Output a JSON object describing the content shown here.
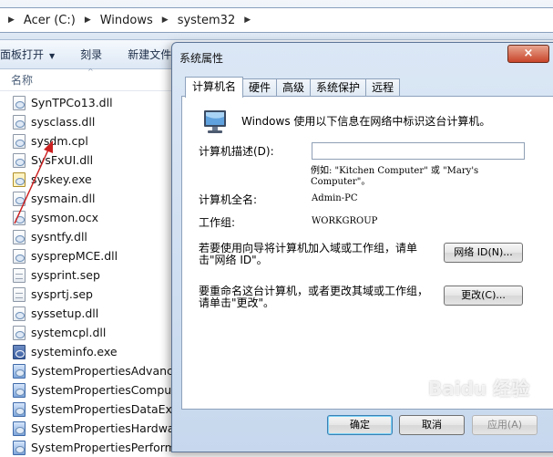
{
  "explorer": {
    "breadcrumb": [
      "Acer (C:)",
      "Windows",
      "system32"
    ],
    "toolbar": {
      "organize": "面板打开",
      "burn": "刻录",
      "new_folder": "新建文件"
    },
    "column_name": "名称",
    "files": [
      {
        "name": "SynTPCo13.dll",
        "icon": "dll-icon"
      },
      {
        "name": "sysclass.dll",
        "icon": "dll-icon"
      },
      {
        "name": "sysdm.cpl",
        "icon": "cpl-icon"
      },
      {
        "name": "SysFxUI.dll",
        "icon": "dll-icon"
      },
      {
        "name": "syskey.exe",
        "icon": "key-exe-icon"
      },
      {
        "name": "sysmain.dll",
        "icon": "dll-icon"
      },
      {
        "name": "sysmon.ocx",
        "icon": "ocx-icon"
      },
      {
        "name": "sysntfy.dll",
        "icon": "dll-icon"
      },
      {
        "name": "sysprepMCE.dll",
        "icon": "dll-icon"
      },
      {
        "name": "sysprint.sep",
        "icon": "doc-icon"
      },
      {
        "name": "sysprtj.sep",
        "icon": "doc-icon"
      },
      {
        "name": "syssetup.dll",
        "icon": "dll-icon"
      },
      {
        "name": "systemcpl.dll",
        "icon": "dll-icon"
      },
      {
        "name": "systeminfo.exe",
        "icon": "exe-icon"
      },
      {
        "name": "SystemPropertiesAdvanced",
        "icon": "sysprop-icon"
      },
      {
        "name": "SystemPropertiesCompute",
        "icon": "sysprop-icon"
      },
      {
        "name": "SystemPropertiesDataExec",
        "icon": "sysprop-icon"
      },
      {
        "name": "SystemPropertiesHardwar",
        "icon": "sysprop-icon"
      },
      {
        "name": "SystemPropertiesPerformance.exe",
        "icon": "sysprop-icon"
      }
    ]
  },
  "dialog": {
    "title": "系统属性",
    "close_glyph": "×",
    "tabs": [
      "计算机名",
      "硬件",
      "高级",
      "系统保护",
      "远程"
    ],
    "active_tab": 0,
    "intro": "Windows 使用以下信息在网络中标识这台计算机。",
    "desc_label": "计算机描述(D):",
    "desc_value": "",
    "example": "例如: \"Kitchen Computer\" 或 \"Mary's Computer\"。",
    "fullname_label": "计算机全名:",
    "fullname_value": "Admin-PC",
    "workgroup_label": "工作组:",
    "workgroup_value": "WORKGROUP",
    "network_text": "若要使用向导将计算机加入域或工作组，请单击\"网络 ID\"。",
    "network_button": "网络 ID(N)...",
    "rename_text": "要重命名这台计算机，或者更改其域或工作组，请单击\"更改\"。",
    "change_button": "更改(C)...",
    "ok_button": "确定",
    "cancel_button": "取消",
    "apply_button": "应用(A)"
  },
  "watermark": "Baidu 经验",
  "colors": {
    "accent": "#3c7fb1",
    "annotation": "#cc2020"
  }
}
